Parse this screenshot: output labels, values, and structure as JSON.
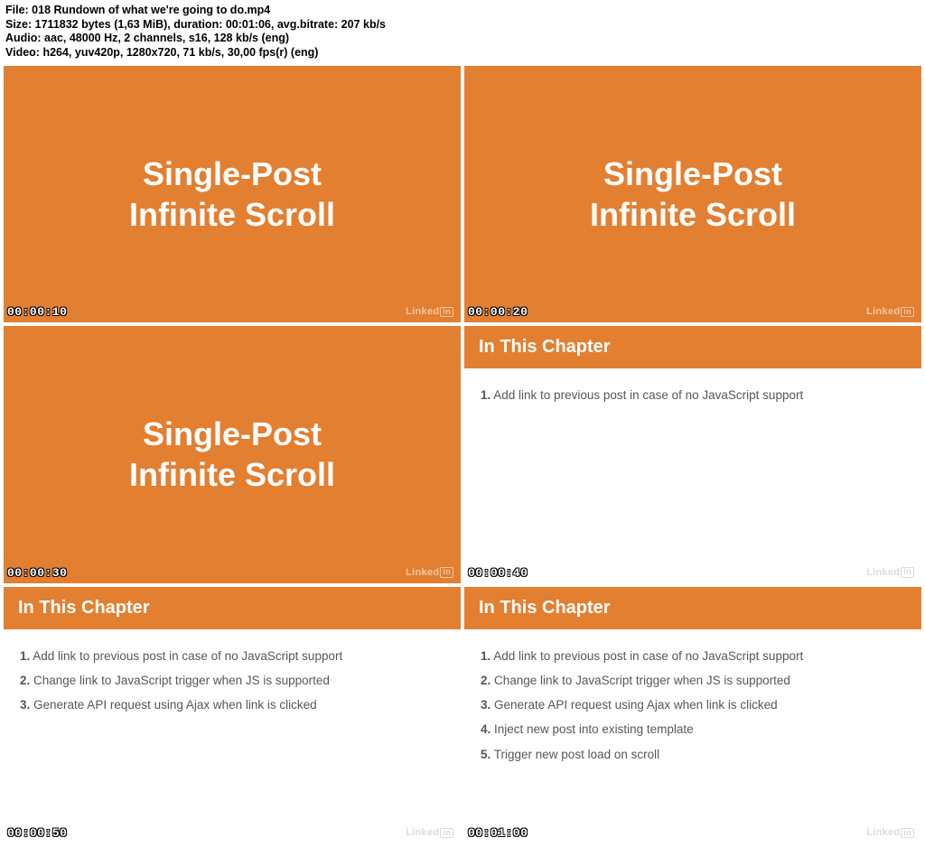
{
  "meta": {
    "file_line": "File: 018 Rundown of what we're going to do.mp4",
    "size_line": "Size: 1711832 bytes (1,63 MiB), duration: 00:01:06, avg.bitrate: 207 kb/s",
    "audio_line": "Audio: aac, 48000 Hz, 2 channels, s16, 128 kb/s (eng)",
    "video_line": "Video: h264, yuv420p, 1280x720, 71 kb/s, 30,00 fps(r) (eng)"
  },
  "watermark": {
    "text": "Linked",
    "box": "in"
  },
  "title_slide": {
    "line1": "Single-Post",
    "line2": "Infinite Scroll"
  },
  "chapter_header": "In This Chapter",
  "steps": [
    "Add link to previous post in case of no JavaScript support",
    "Change link to JavaScript trigger when JS is supported",
    "Generate API request using Ajax when link is clicked",
    "Inject new post into existing template",
    "Trigger new post load on scroll"
  ],
  "thumbs": [
    {
      "kind": "title",
      "ts": "00:00:10",
      "wm": "light"
    },
    {
      "kind": "title",
      "ts": "00:00:20",
      "wm": "light"
    },
    {
      "kind": "title",
      "ts": "00:00:30",
      "wm": "light"
    },
    {
      "kind": "chapter",
      "ts": "00:00:40",
      "wm": "dark",
      "step_count": 1
    },
    {
      "kind": "chapter",
      "ts": "00:00:50",
      "wm": "dark",
      "step_count": 3
    },
    {
      "kind": "chapter",
      "ts": "00:01:00",
      "wm": "dark",
      "step_count": 5
    }
  ]
}
